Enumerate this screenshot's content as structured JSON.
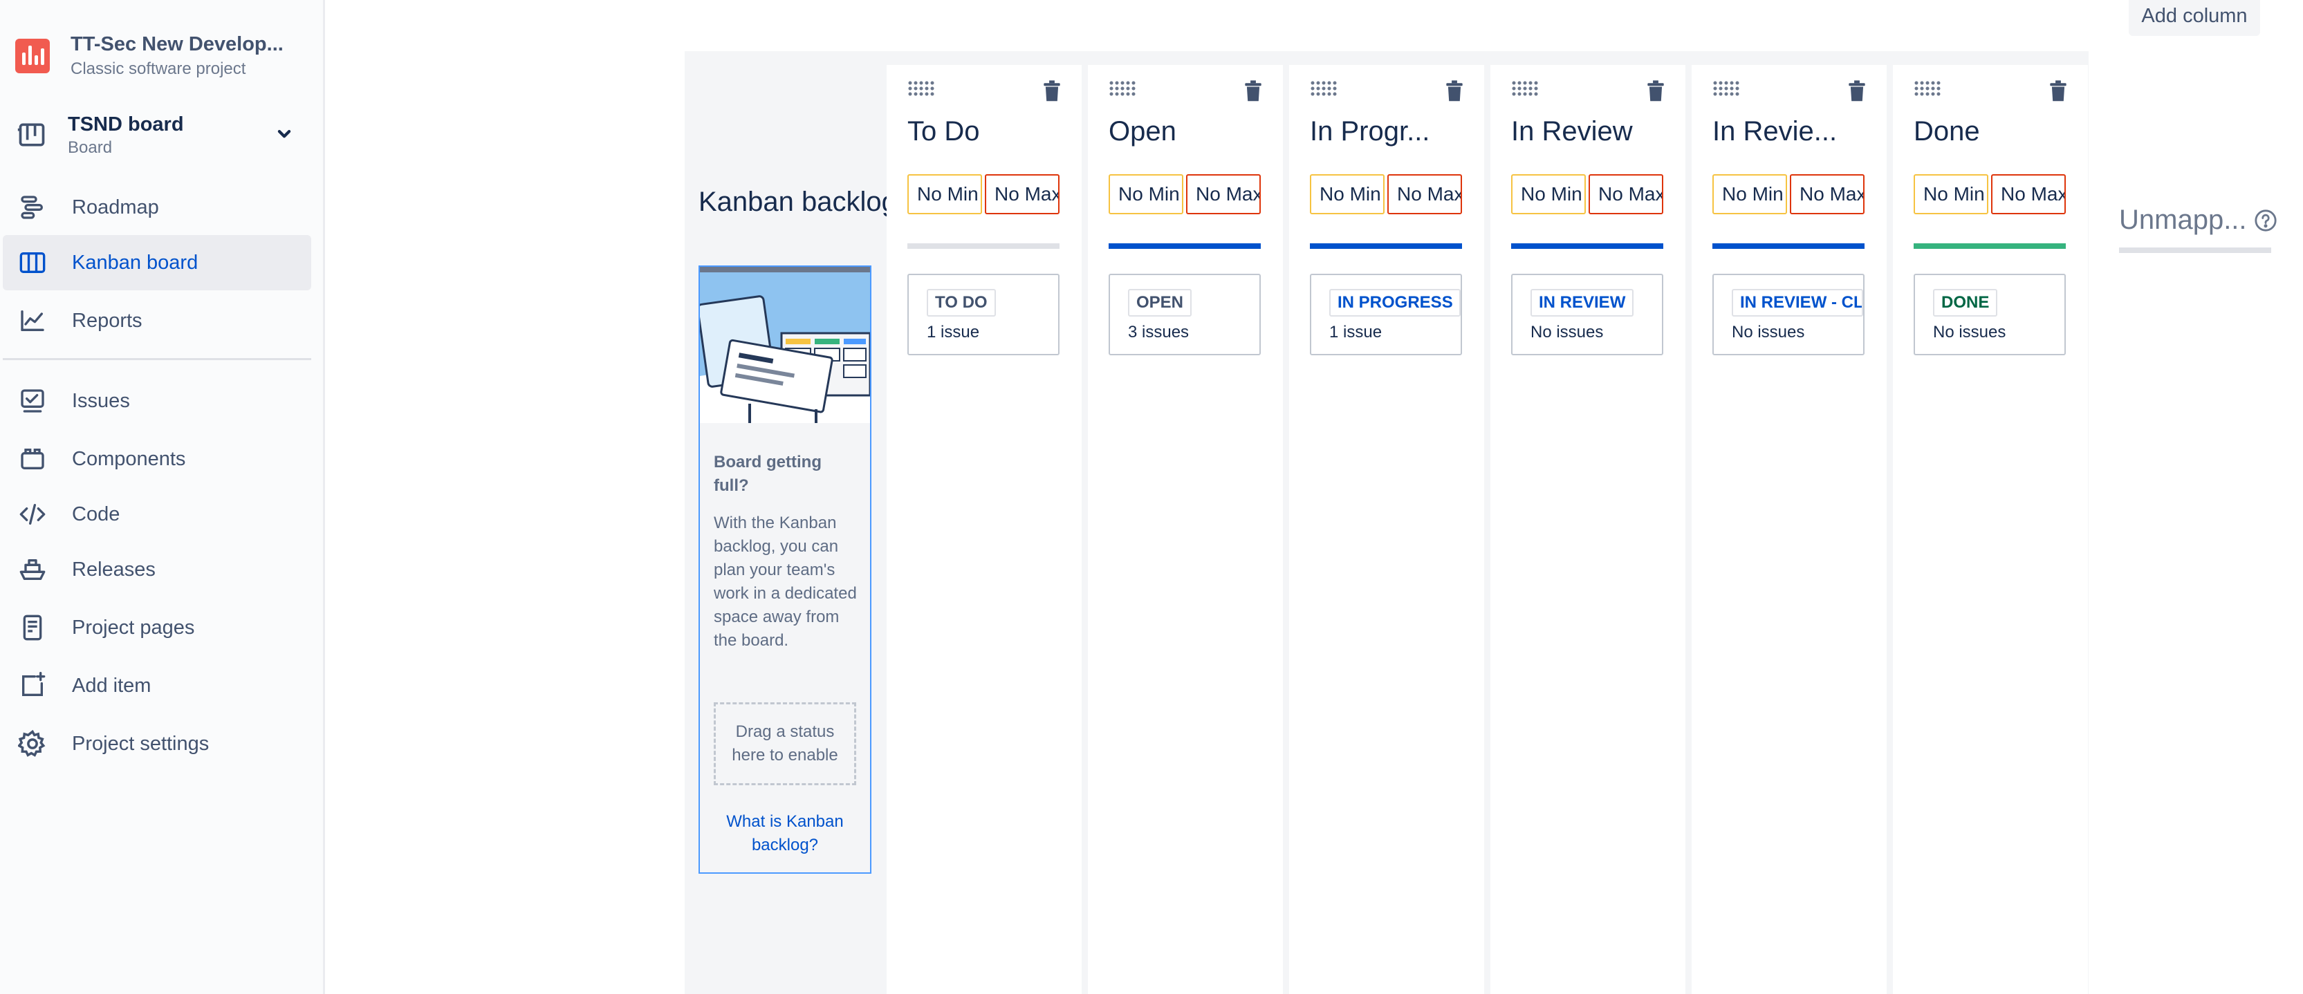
{
  "project": {
    "name": "TT-Sec New Develop...",
    "type": "Classic software project"
  },
  "board": {
    "name": "TSND board",
    "subtitle": "Board"
  },
  "nav": {
    "roadmap": "Roadmap",
    "kanban_board": "Kanban board",
    "reports": "Reports",
    "issues": "Issues",
    "components": "Components",
    "code": "Code",
    "releases": "Releases",
    "project_pages": "Project pages",
    "add_item": "Add item",
    "project_settings": "Project settings"
  },
  "toolbar": {
    "add_column": "Add column"
  },
  "backlog": {
    "title": "Kanban backlog",
    "heading": "Board getting full?",
    "body": "With the Kanban backlog, you can plan your team's work in a dedicated space away from the board.",
    "drop_hint": "Drag a status here to enable",
    "link": "What is Kanban backlog?"
  },
  "columns": [
    {
      "name": "To Do",
      "min": "No Min",
      "max": "No Max",
      "status": "TO DO",
      "count": "1 issue",
      "bar_color": "#dfe1e6",
      "status_color": "#42526e"
    },
    {
      "name": "Open",
      "min": "No Min",
      "max": "No Max",
      "status": "OPEN",
      "count": "3 issues",
      "bar_color": "#0052cc",
      "status_color": "#42526e"
    },
    {
      "name": "In Progr...",
      "min": "No Min",
      "max": "No Max",
      "status": "IN PROGRESS",
      "count": "1 issue",
      "bar_color": "#0052cc",
      "status_color": "#0052cc"
    },
    {
      "name": "In Review",
      "min": "No Min",
      "max": "No Max",
      "status": "IN REVIEW",
      "count": "No issues",
      "bar_color": "#0052cc",
      "status_color": "#0052cc"
    },
    {
      "name": "In Revie...",
      "min": "No Min",
      "max": "No Max",
      "status": "IN REVIEW - CL",
      "count": "No issues",
      "bar_color": "#0052cc",
      "status_color": "#0052cc"
    },
    {
      "name": "Done",
      "min": "No Min",
      "max": "No Max",
      "status": "DONE",
      "count": "No issues",
      "bar_color": "#36b37e",
      "status_color": "#006644"
    }
  ],
  "unmapped": {
    "title": "Unmapp..."
  },
  "colors": {
    "accent": "#0052cc",
    "done": "#36b37e",
    "min_border": "#f6c342",
    "max_border": "#de350b"
  }
}
